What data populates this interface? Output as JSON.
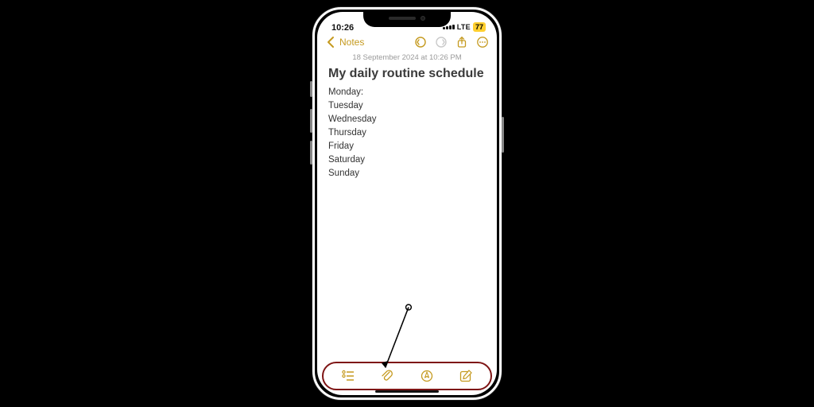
{
  "status": {
    "time": "10:26",
    "network": "LTE",
    "battery": "77"
  },
  "nav": {
    "back_label": "Notes"
  },
  "note": {
    "date": "18 September 2024 at 10:26 PM",
    "title": "My daily routine schedule",
    "lines": [
      "Monday:",
      "Tuesday",
      "Wednesday",
      "Thursday",
      "Friday",
      "Saturday",
      "Sunday"
    ]
  },
  "colors": {
    "accent": "#c59a1f",
    "highlight_ring": "#7e1414"
  }
}
